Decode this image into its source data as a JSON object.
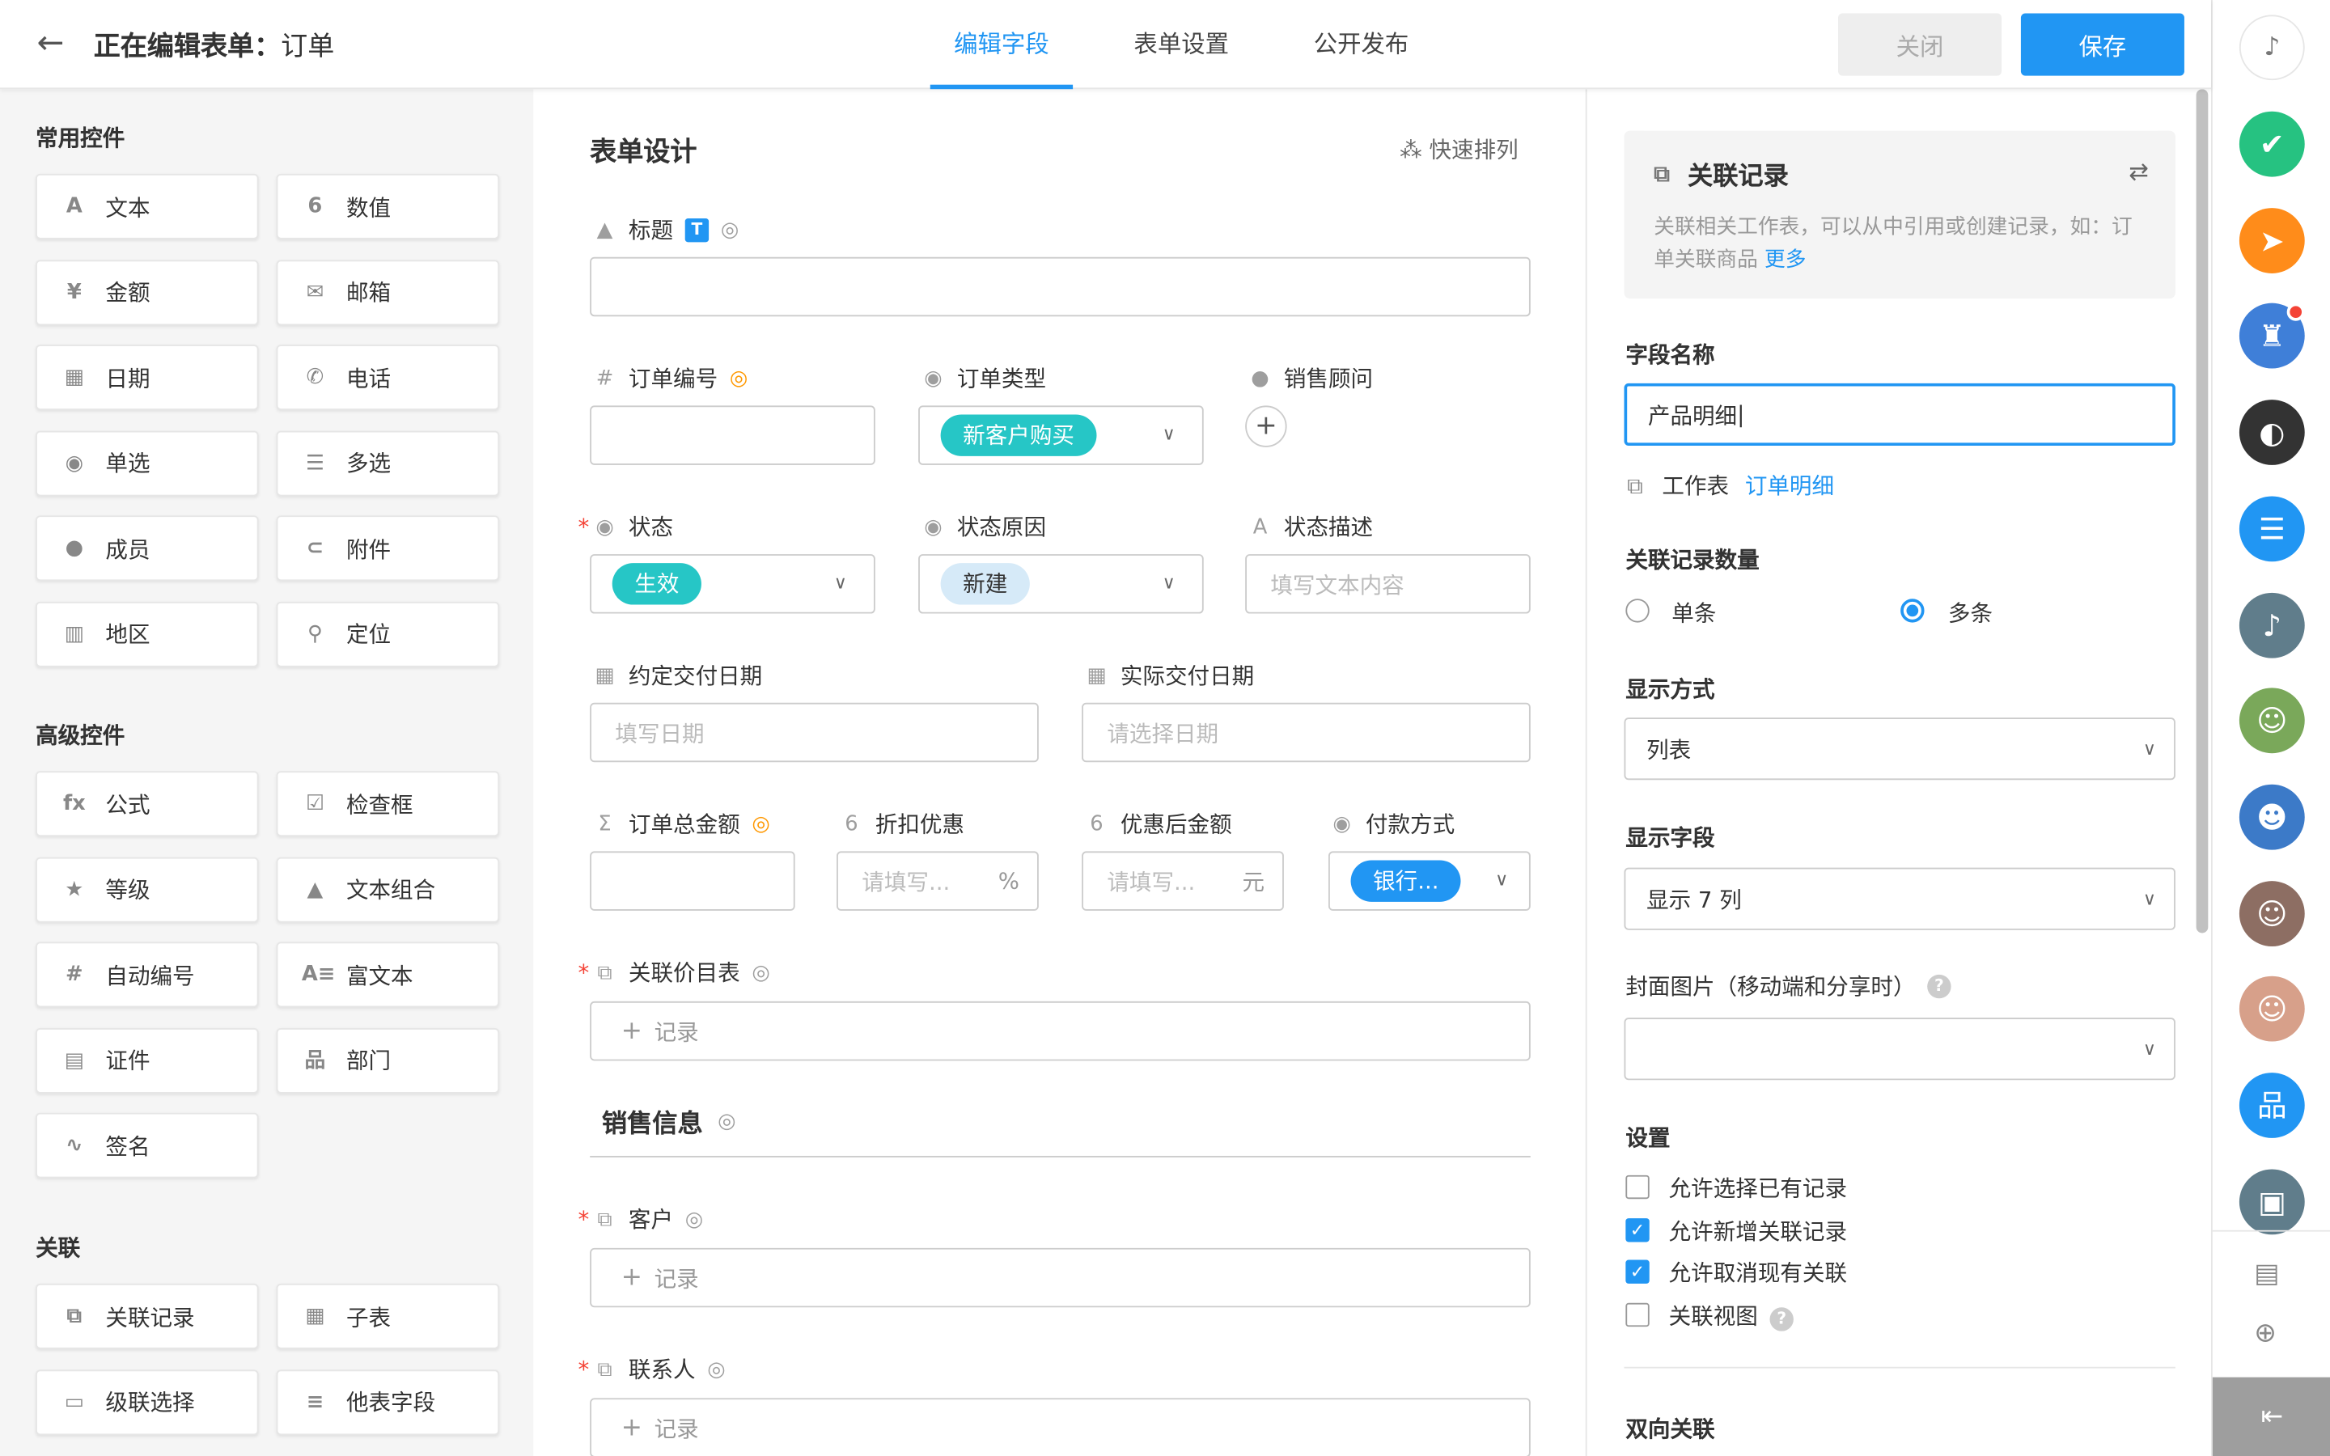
{
  "header": {
    "title_prefix": "正在编辑表单：",
    "title_name": "订单",
    "tabs": [
      {
        "label": "编辑字段"
      },
      {
        "label": "表单设置"
      },
      {
        "label": "公开发布"
      }
    ],
    "close_label": "关闭",
    "save_label": "保存"
  },
  "left": {
    "common_title": "常用控件",
    "common": [
      {
        "label": "文本",
        "icon": "text-icon",
        "glyph": "A"
      },
      {
        "label": "数值",
        "icon": "number-icon",
        "glyph": "6"
      },
      {
        "label": "金额",
        "icon": "money-icon",
        "glyph": "¥"
      },
      {
        "label": "邮箱",
        "icon": "mail-icon",
        "glyph": "✉"
      },
      {
        "label": "日期",
        "icon": "calendar-icon",
        "glyph": "▦"
      },
      {
        "label": "电话",
        "icon": "phone-icon",
        "glyph": "✆"
      },
      {
        "label": "单选",
        "icon": "single-select-icon",
        "glyph": "◉"
      },
      {
        "label": "多选",
        "icon": "multi-select-icon",
        "glyph": "☰"
      },
      {
        "label": "成员",
        "icon": "member-icon",
        "glyph": "●"
      },
      {
        "label": "附件",
        "icon": "attachment-icon",
        "glyph": "⊂"
      },
      {
        "label": "地区",
        "icon": "map-icon",
        "glyph": "▥"
      },
      {
        "label": "定位",
        "icon": "location-pin-icon",
        "glyph": "⚲"
      }
    ],
    "advanced_title": "高级控件",
    "advanced": [
      {
        "label": "公式",
        "icon": "formula-icon",
        "glyph": "fx"
      },
      {
        "label": "检查框",
        "icon": "checkbox-icon",
        "glyph": "☑"
      },
      {
        "label": "等级",
        "icon": "star-icon",
        "glyph": "★"
      },
      {
        "label": "文本组合",
        "icon": "shapes-icon",
        "glyph": "▲"
      },
      {
        "label": "自动编号",
        "icon": "hash-icon",
        "glyph": "#"
      },
      {
        "label": "富文本",
        "icon": "rich-text-icon",
        "glyph": "A≡"
      },
      {
        "label": "证件",
        "icon": "id-card-icon",
        "glyph": "▤"
      },
      {
        "label": "部门",
        "icon": "org-icon",
        "glyph": "品"
      },
      {
        "label": "签名",
        "icon": "signature-icon",
        "glyph": "∿"
      }
    ],
    "relation_title": "关联",
    "relation": [
      {
        "label": "关联记录",
        "icon": "link-record-icon",
        "glyph": "⧉"
      },
      {
        "label": "子表",
        "icon": "table-icon",
        "glyph": "▦"
      },
      {
        "label": "级联选择",
        "icon": "cascade-icon",
        "glyph": "▭"
      },
      {
        "label": "他表字段",
        "icon": "other-field-icon",
        "glyph": "≡"
      }
    ]
  },
  "center": {
    "form_title": "表单设计",
    "quick_sort": "快速排列",
    "fields": {
      "title_label": "标题",
      "title_badge": "T",
      "order_no": "订单编号",
      "order_type": "订单类型",
      "order_type_value": "新客户购买",
      "sales": "销售顾问",
      "status": "状态",
      "status_value": "生效",
      "status_reason": "状态原因",
      "status_reason_value": "新建",
      "status_desc": "状态描述",
      "status_desc_placeholder": "填写文本内容",
      "agreed_date": "约定交付日期",
      "agreed_date_placeholder": "填写日期",
      "actual_date": "实际交付日期",
      "actual_date_placeholder": "请选择日期",
      "total": "订单总金额",
      "discount": "折扣优惠",
      "discount_placeholder": "请填写...",
      "discount_unit": "%",
      "after": "优惠后金额",
      "after_placeholder": "请填写...",
      "after_unit": "元",
      "payment": "付款方式",
      "payment_value": "银行...",
      "pricelist": "关联价目表",
      "record_placeholder": "记录",
      "section": "销售信息",
      "customer": "客户",
      "contact": "联系人"
    }
  },
  "right": {
    "info_title": "关联记录",
    "info_desc": "关联相关工作表，可以从中引用或创建记录，如：订单关联商品",
    "info_more": "更多",
    "field_name_label": "字段名称",
    "field_name_value": "产品明细",
    "worksheet_label": "工作表",
    "worksheet_link": "订单明细",
    "count_label": "关联记录数量",
    "count_single": "单条",
    "count_multi": "多条",
    "display_label": "显示方式",
    "display_value": "列表",
    "fields_label": "显示字段",
    "fields_value": "显示 7 列",
    "cover_label": "封面图片（移动端和分享时）",
    "settings_label": "设置",
    "settings": [
      {
        "label": "允许选择已有记录",
        "checked": false
      },
      {
        "label": "允许新增关联记录",
        "checked": true
      },
      {
        "label": "允许取消现有关联",
        "checked": true
      },
      {
        "label": "关联视图",
        "checked": false
      }
    ],
    "twoway_label": "双向关联"
  },
  "dock": {
    "items": [
      {
        "name": "check-app-icon",
        "glyph": "✔",
        "color": "#26c281"
      },
      {
        "name": "send-app-icon",
        "glyph": "➤",
        "color": "#ff8c1a"
      },
      {
        "name": "robot-app-icon",
        "glyph": "♜",
        "color": "#3f7fd8"
      },
      {
        "name": "avatar-dark-icon",
        "glyph": "◐",
        "color": "#333333"
      },
      {
        "name": "chat-app-icon",
        "glyph": "☰",
        "color": "#2196f3"
      },
      {
        "name": "bell-app-icon",
        "glyph": "♪",
        "color": "#607d8b"
      },
      {
        "name": "avatar-game-icon",
        "glyph": "☺",
        "color": "#7aa85a"
      },
      {
        "name": "avatar-vault-icon",
        "glyph": "☻",
        "color": "#3c7ac8"
      },
      {
        "name": "avatar-person-icon",
        "glyph": "☺",
        "color": "#8d6e63"
      },
      {
        "name": "avatar-girl-icon",
        "glyph": "☺",
        "color": "#d7a08a"
      },
      {
        "name": "org-app-icon",
        "glyph": "品",
        "color": "#2196f3"
      },
      {
        "name": "briefcase-app-icon",
        "glyph": "▣",
        "color": "#607d8b"
      }
    ]
  }
}
